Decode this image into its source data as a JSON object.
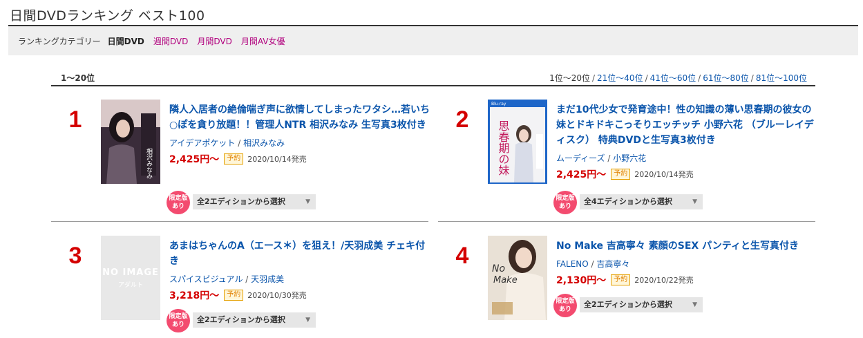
{
  "header": {
    "title": "日間DVDランキング ベスト100"
  },
  "category": {
    "label": "ランキングカテゴリー",
    "current": "日間DVD",
    "links": [
      "週間DVD",
      "月間DVD",
      "月間AV女優"
    ]
  },
  "range": {
    "current": "1〜20位",
    "links": [
      "1位〜20位",
      "21位〜40位",
      "41位〜60位",
      "61位〜80位",
      "81位〜100位"
    ]
  },
  "items": [
    {
      "rank": "1",
      "title": "隣人入居者の絶倫喘ぎ声に欲情してしまったワタシ…若いち○ぽを貪り放題！！管理人NTR 相沢みなみ 生写真3枚付き",
      "maker": "アイデアポケット",
      "actress": "相沢みなみ",
      "price": "2,425円〜",
      "badge": "予約",
      "date": "2020/10/14発売",
      "limited": "限定版あり",
      "edition": "全2エディションから選択"
    },
    {
      "rank": "2",
      "title": "まだ10代少女で発育途中！性の知識の薄い思春期の彼女の妹とドキドキこっそりエッチッチ 小野六花 （ブルーレイディスク） 特典DVDと生写真3枚付き",
      "maker": "ムーディーズ",
      "actress": "小野六花",
      "price": "2,425円〜",
      "badge": "予約",
      "date": "2020/10/14発売",
      "limited": "限定版あり",
      "edition": "全4エディションから選択"
    },
    {
      "rank": "3",
      "title": "あまはちゃんのA（エース＊）を狙え！/天羽成美 チェキ付き",
      "maker": "スパイスビジュアル",
      "actress": "天羽成美",
      "price": "3,218円〜",
      "badge": "予約",
      "date": "2020/10/30発売",
      "limited": "限定版あり",
      "edition": "全2エディションから選択",
      "noimage": {
        "line1": "NO IMAGE",
        "line2": "アダルト"
      }
    },
    {
      "rank": "4",
      "title": "No Make 吉高寧々 素顔のSEX パンティと生写真付き",
      "maker": "FALENO",
      "actress": "吉高寧々",
      "price": "2,130円〜",
      "badge": "予約",
      "date": "2020/10/22発売",
      "limited": "限定版あり",
      "edition": "全2エディションから選択"
    }
  ],
  "colors": {
    "accent_link": "#0b55ab",
    "category_link": "#b1007e",
    "rank": "#d40000",
    "limited_badge": "#f34b6f"
  }
}
